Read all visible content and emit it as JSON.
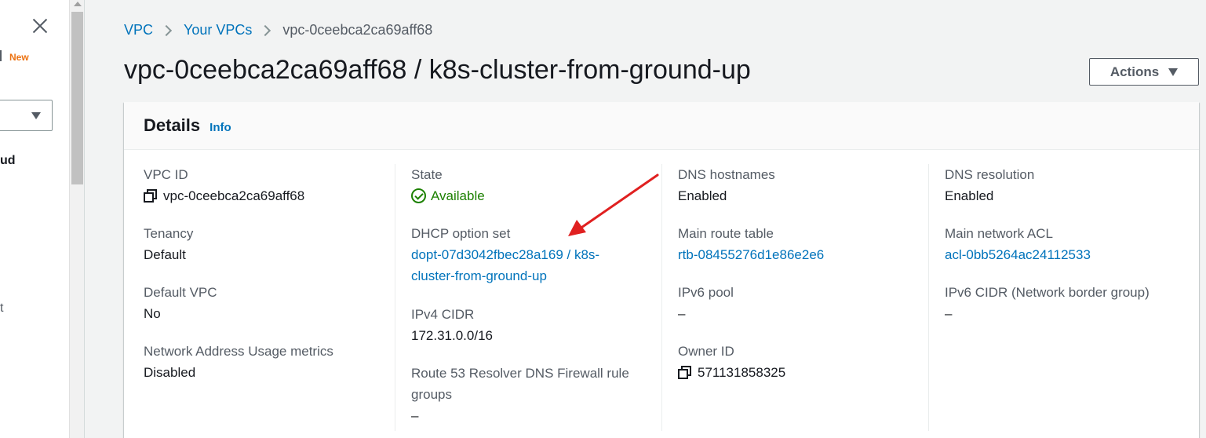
{
  "sidenav": {
    "new_badge": "New",
    "partial_text_1": "ud",
    "partial_text_2": "t"
  },
  "breadcrumb": [
    {
      "label": "VPC"
    },
    {
      "label": "Your VPCs"
    },
    {
      "label": "vpc-0ceebca2ca69aff68"
    }
  ],
  "page": {
    "title": "vpc-0ceebca2ca69aff68 / k8s-cluster-from-ground-up",
    "actions_label": "Actions"
  },
  "details": {
    "title": "Details",
    "info_label": "Info",
    "col1": {
      "vpc_id": {
        "label": "VPC ID",
        "value": "vpc-0ceebca2ca69aff68"
      },
      "tenancy": {
        "label": "Tenancy",
        "value": "Default"
      },
      "default_vpc": {
        "label": "Default VPC",
        "value": "No"
      },
      "nau_metrics": {
        "label": "Network Address Usage metrics",
        "value": "Disabled"
      }
    },
    "col2": {
      "state": {
        "label": "State",
        "value": "Available"
      },
      "dhcp": {
        "label": "DHCP option set",
        "value_line1": "dopt-07d3042fbec28a169 / k8s-",
        "value_line2": "cluster-from-ground-up"
      },
      "ipv4_cidr": {
        "label": "IPv4 CIDR",
        "value": "172.31.0.0/16"
      },
      "route53": {
        "label_line1": "Route 53 Resolver DNS Firewall rule",
        "label_line2": "groups",
        "value": "–"
      }
    },
    "col3": {
      "dns_hostnames": {
        "label": "DNS hostnames",
        "value": "Enabled"
      },
      "main_route_table": {
        "label": "Main route table",
        "value": "rtb-08455276d1e86e2e6"
      },
      "ipv6_pool": {
        "label": "IPv6 pool",
        "value": "–"
      },
      "owner_id": {
        "label": "Owner ID",
        "value": "571131858325"
      }
    },
    "col4": {
      "dns_resolution": {
        "label": "DNS resolution",
        "value": "Enabled"
      },
      "main_network_acl": {
        "label": "Main network ACL",
        "value": "acl-0bb5264ac24112533"
      },
      "ipv6_cidr": {
        "label": "IPv6 CIDR (Network border group)",
        "value": "–"
      }
    }
  },
  "colors": {
    "link": "#0073bb",
    "success": "#1d8102",
    "annotation_arrow": "#e02020",
    "new_badge": "#ec7211"
  }
}
